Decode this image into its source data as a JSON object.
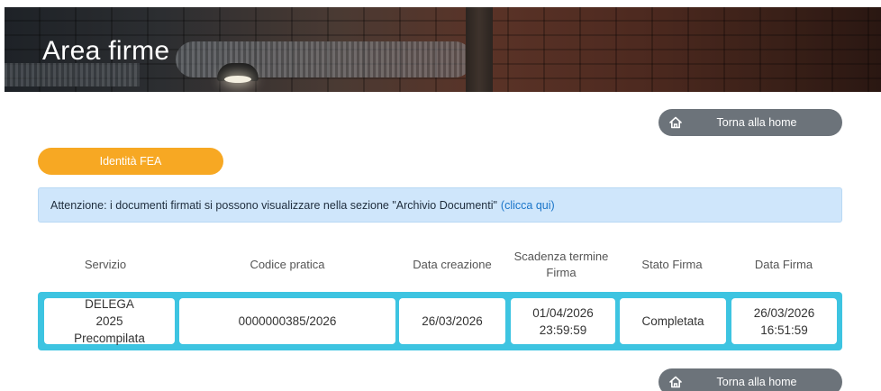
{
  "header": {
    "title": "Area firme"
  },
  "home_button": {
    "label": "Torna alla home",
    "icon": "home-icon"
  },
  "fea_button": {
    "label": "Identità FEA"
  },
  "alert": {
    "text": "Attenzione: i documenti firmati si possono visualizzare nella sezione \"Archivio Documenti\"",
    "link": "(clicca qui)"
  },
  "table": {
    "headers": [
      "Servizio",
      "Codice pratica",
      "Data creazione",
      "Scadenza termine Firma",
      "Stato Firma",
      "Data Firma"
    ],
    "rows": [
      {
        "servizio": "DELEGA 2025 Precompilata",
        "codice": "0000000385/2026",
        "data_creazione": "26/03/2026",
        "scadenza": "01/04/2026 23:59:59",
        "stato": "Completata",
        "data_firma": "26/03/2026 16:51:59"
      }
    ]
  },
  "colors": {
    "orange": "#f7a823",
    "row_accent": "#3dc4e1",
    "alert_bg": "#cfe6fb",
    "button_grey": "#6c737a",
    "link": "#1a75c9"
  }
}
